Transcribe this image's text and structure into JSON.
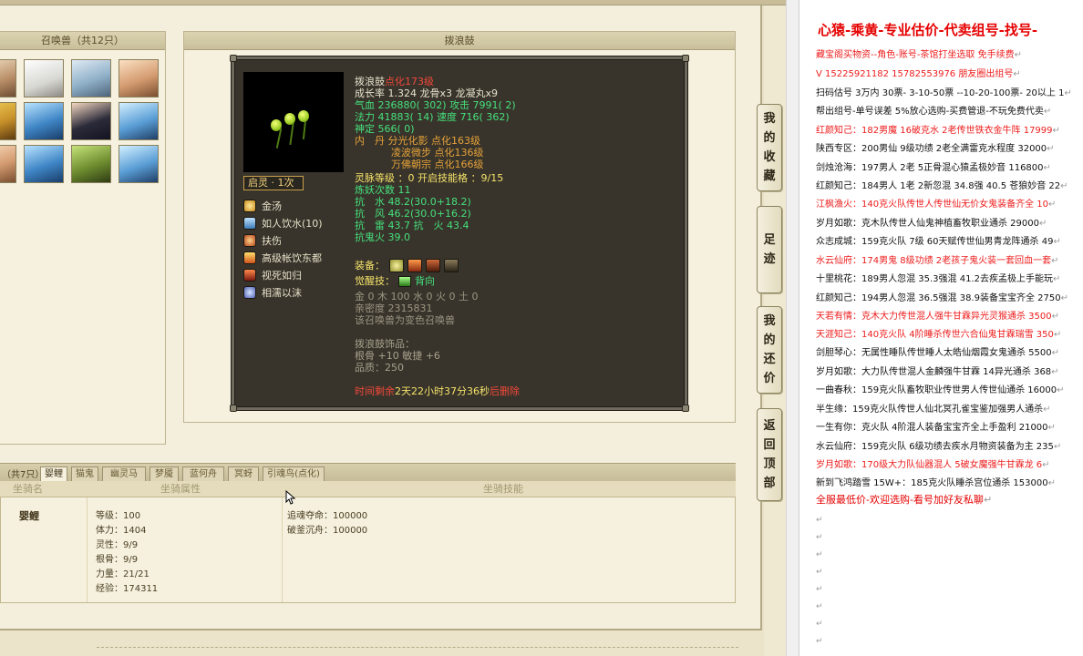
{
  "summon_panel": {
    "title": "召唤兽（共12只）"
  },
  "center_panel": {
    "title": "拨浪鼓"
  },
  "tooltip": {
    "name": "拨浪鼓",
    "name_note": "点化173级",
    "growth_line": "成长率 1.324 龙骨x3 龙凝丸x9",
    "hp_label": "气血 236880( 302) ",
    "attack": "攻击 7991( 2)",
    "mp_label": "法力 41883( 14) ",
    "speed": "速度 716( 362)",
    "shen": "神定 566( 0)",
    "neidan_1": "内　丹 分光化影 点化163级",
    "neidan_2": "凌波微步 点化136级",
    "neidan_3": "万佛朝宗 点化166级",
    "spirit_level": "灵脉等级 ：0 开启技能格 ：9/15",
    "refine_count": "炼妖次数 11",
    "resist_water": "抗　水 48.2(30.0+18.2)",
    "resist_wind": "抗　风 46.2(30.0+16.2)",
    "resist_thunder": "抗　雷 43.7 抗　火 43.4",
    "resist_ghost": "抗鬼火 39.0",
    "equip_label": "装备：",
    "awaken_skill_label": "觉醒技：",
    "awaken_skill": "背向",
    "elements": "金 0 木 100 水 0 火 0 土 0",
    "intimacy": "亲密度 2315831",
    "variant_note": "该召唤兽为变色召唤兽",
    "ornament_title": "拨浪鼓饰品：",
    "ornament_stats": "根骨 +10 敏捷 +6",
    "ornament_quality": "品质：250",
    "time_prefix": "时间剩余",
    "time_value": "2天22小时37分36秒",
    "time_suffix": "后删除",
    "awaken_box": "启灵 · 1次",
    "skills": [
      "金汤",
      "如人饮水(10)",
      "扶伤",
      "高级帐饮东都",
      "视死如归",
      "相濡以沫"
    ]
  },
  "mount": {
    "tab_count": "（共7只）",
    "tabs": [
      "婴鲤",
      "猫鬼",
      "幽灵马",
      "梦魇",
      "蓝何舟",
      "冥蚜",
      "引魂鸟(点化)"
    ],
    "headers": {
      "name": "坐骑名",
      "attr": "坐骑属性",
      "skill": "坐骑技能"
    },
    "name": "婴鲤",
    "attrs": [
      "等级：100",
      "体力：1404",
      "灵性：9/9",
      "根骨：9/9",
      "力量：21/21",
      "经验：174311"
    ],
    "skills": [
      "追魂夺命：100000",
      "破釜沉舟：100000"
    ]
  },
  "sidenav": {
    "collection": [
      "我",
      "的",
      "收",
      "藏"
    ],
    "footprint": [
      "足",
      "迹"
    ],
    "bargain": [
      "我",
      "的",
      "还",
      "价"
    ],
    "top": [
      "返",
      "回",
      "顶",
      "部"
    ]
  },
  "doc": {
    "headline": "心猿-乘黄-专业估价-代卖组号-找号-",
    "lines": [
      {
        "text": "藏宝阁买物资--角色-账号-茶馆打坐选取 免手续费",
        "red": true
      },
      {
        "text": "V 15225921182 15782553976 朋友圈出组号",
        "red": true
      },
      {
        "text": "扫码估号 3万内 30票- 3-10-50票 --10-20-100票- 20以上 1",
        "red": false
      },
      {
        "text": "帮出组号-单号误差 5%放心选购-买费管退-不玩免费代卖",
        "red": false
      },
      {
        "text": "红颜知己：182男魔 16破克水 2老传世铁衣金牛阵 17999",
        "red": true
      },
      {
        "text": "陕西专区：200男仙 9级功绩 2老全满雷克水程度 32000",
        "red": false
      },
      {
        "text": "剑烛沧海：197男人 2老 5正骨混心猿孟极妙音 116800",
        "red": false
      },
      {
        "text": "红颜知己：184男人 1老 2新忽混 34.8强 40.5 苍狼妙音 22",
        "red": false
      },
      {
        "text": "江枫渔火：140克火队传世人传世仙无价女鬼装备齐全 10",
        "red": true
      },
      {
        "text": "岁月如歌：克木队传世人仙鬼神植畜牧职业通杀 29000",
        "red": false
      },
      {
        "text": "众志成城：159克火队 7级 60天赋传世仙男青龙阵通杀 49",
        "red": false
      },
      {
        "text": "水云仙府：174男鬼 8级功绩 2老孩子鬼火装一套回血一套",
        "red": true
      },
      {
        "text": "十里桃花：189男人忽混 35.3强混 41.2去疾孟极上手能玩",
        "red": false
      },
      {
        "text": "红颜知己：194男人忽混 36.5强混 38.9装备宝宝齐全 2750",
        "red": false
      },
      {
        "text": "天若有情：克木大力传世混人强牛甘霖异光灵猴通杀 3500",
        "red": true
      },
      {
        "text": "天涯知己：140克火队 4阶睡杀传世六合仙鬼甘霖瑞雪 350",
        "red": true
      },
      {
        "text": "剑胆琴心：无属性睡队传世睡人太皓仙烟霞女鬼通杀 5500",
        "red": false
      },
      {
        "text": "岁月如歌：大力队传世混人金麟强牛甘霖 14异光通杀 368",
        "red": false
      },
      {
        "text": "一曲春秋：159克火队畜牧职业传世男人传世仙通杀 16000",
        "red": false
      },
      {
        "text": "半生缘：159克火队传世人仙北冥孔雀宝鉴加强男人通杀",
        "red": false
      },
      {
        "text": "一生有你：克火队 4阶混人装备宝宝齐全上手盈利 21000",
        "red": false
      },
      {
        "text": "水云仙府：159克火队 6级功绩去疾水月物资装备为主 235",
        "red": false
      },
      {
        "text": "岁月如歌：170级大力队仙器混人 5破女魔强牛甘霖龙 6",
        "red": true
      },
      {
        "text": "新到飞鸿踏雪 15W+：185克火队睡杀宫位通杀 153000",
        "red": false
      }
    ],
    "footer": "全服最低价-欢迎选购-看号加好友私聊",
    "paragraph_mark": "↵"
  }
}
